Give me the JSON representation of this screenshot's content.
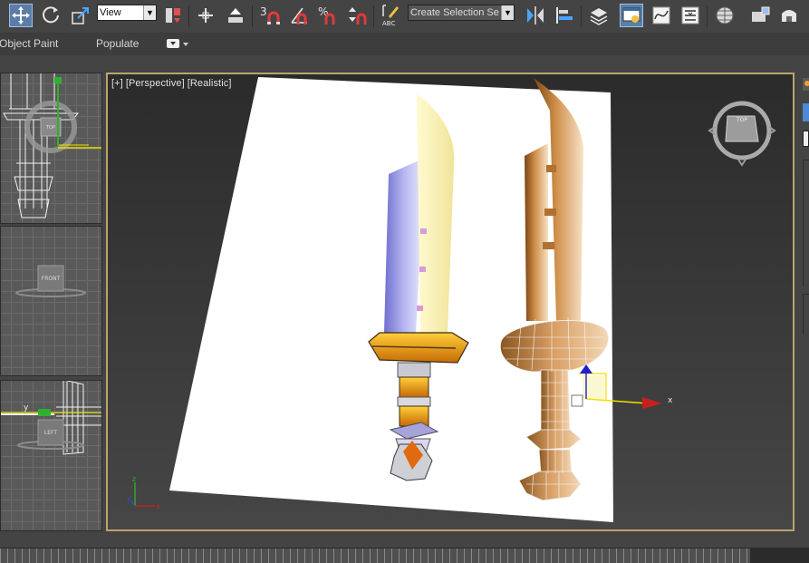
{
  "toolbar": {
    "reference_coord": "View",
    "named_selection_placeholder": "Create Selection Se",
    "snap_2d_label": "3",
    "percent_snap_label": "%",
    "edit_named_sel_label": "ABC",
    "active_accent": "#5a7ea8"
  },
  "ribbon": {
    "tabs": [
      "Object Paint",
      "Populate"
    ]
  },
  "viewports": {
    "top_cube": "TOP",
    "front_cube": "FRONT",
    "left_cube": "LEFT",
    "left_axis_label": "y",
    "main": {
      "label_plus": "[+]",
      "label_view": "[Perspective]",
      "label_shading": "[Realistic]",
      "viewcube_label": "TOP",
      "gizmo_x_label": "x",
      "axis_tripod_x": "x",
      "axis_tripod_y": "y",
      "axis_tripod_z": "z",
      "border_color": "#b9a56c"
    }
  },
  "icons": [
    "select-move-icon",
    "rotate-icon",
    "scale-icon",
    "named-selection-icon",
    "pivot-icon",
    "align-icon",
    "snap-2d-icon",
    "angle-snap-icon",
    "percent-snap-icon",
    "spinner-snap-icon",
    "edit-named-sets-icon",
    "mirror-icon",
    "align-tool-icon",
    "layers-icon",
    "scene-explorer-icon",
    "curve-editor-icon",
    "schematic-view-icon",
    "material-editor-icon",
    "render-setup-icon",
    "render-icon"
  ]
}
